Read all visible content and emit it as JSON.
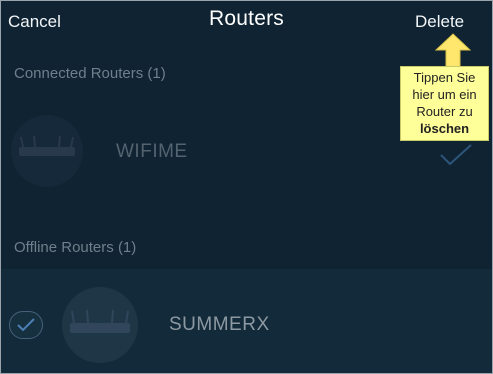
{
  "header": {
    "cancel_label": "Cancel",
    "title": "Routers",
    "delete_label": "Delete"
  },
  "connected": {
    "section_label": "Connected Routers  (1)",
    "routers": [
      {
        "name": "WIFIME",
        "selected": true
      }
    ]
  },
  "offline": {
    "section_label": "Offline Routers  (1)",
    "routers": [
      {
        "name": "SUMMERX",
        "selected": true
      }
    ]
  },
  "callout": {
    "line1": "Tippen Sie",
    "line2": "hier um ein",
    "line3": "Router zu",
    "line4": "löschen"
  },
  "colors": {
    "background": "#0f2332",
    "callout_background": "#ffff99",
    "callout_arrow": "#ffe66d",
    "accent": "#4a7fb5"
  },
  "icons": {
    "router": "router-icon",
    "check": "checkmark-icon",
    "arrow": "arrow-up-icon"
  }
}
